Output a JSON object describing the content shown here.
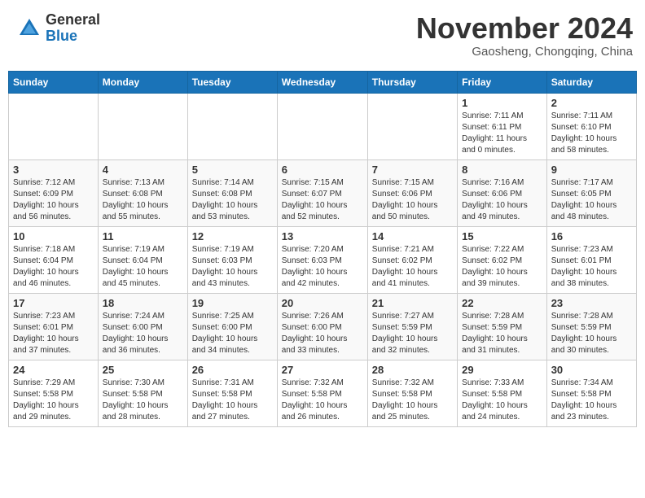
{
  "header": {
    "logo": {
      "general": "General",
      "blue": "Blue"
    },
    "title": "November 2024",
    "subtitle": "Gaosheng, Chongqing, China"
  },
  "calendar": {
    "weekdays": [
      "Sunday",
      "Monday",
      "Tuesday",
      "Wednesday",
      "Thursday",
      "Friday",
      "Saturday"
    ],
    "weeks": [
      [
        {
          "day": "",
          "sunrise": "",
          "sunset": "",
          "daylight": ""
        },
        {
          "day": "",
          "sunrise": "",
          "sunset": "",
          "daylight": ""
        },
        {
          "day": "",
          "sunrise": "",
          "sunset": "",
          "daylight": ""
        },
        {
          "day": "",
          "sunrise": "",
          "sunset": "",
          "daylight": ""
        },
        {
          "day": "",
          "sunrise": "",
          "sunset": "",
          "daylight": ""
        },
        {
          "day": "1",
          "sunrise": "Sunrise: 7:11 AM",
          "sunset": "Sunset: 6:11 PM",
          "daylight": "Daylight: 11 hours and 0 minutes."
        },
        {
          "day": "2",
          "sunrise": "Sunrise: 7:11 AM",
          "sunset": "Sunset: 6:10 PM",
          "daylight": "Daylight: 10 hours and 58 minutes."
        }
      ],
      [
        {
          "day": "3",
          "sunrise": "Sunrise: 7:12 AM",
          "sunset": "Sunset: 6:09 PM",
          "daylight": "Daylight: 10 hours and 56 minutes."
        },
        {
          "day": "4",
          "sunrise": "Sunrise: 7:13 AM",
          "sunset": "Sunset: 6:08 PM",
          "daylight": "Daylight: 10 hours and 55 minutes."
        },
        {
          "day": "5",
          "sunrise": "Sunrise: 7:14 AM",
          "sunset": "Sunset: 6:08 PM",
          "daylight": "Daylight: 10 hours and 53 minutes."
        },
        {
          "day": "6",
          "sunrise": "Sunrise: 7:15 AM",
          "sunset": "Sunset: 6:07 PM",
          "daylight": "Daylight: 10 hours and 52 minutes."
        },
        {
          "day": "7",
          "sunrise": "Sunrise: 7:15 AM",
          "sunset": "Sunset: 6:06 PM",
          "daylight": "Daylight: 10 hours and 50 minutes."
        },
        {
          "day": "8",
          "sunrise": "Sunrise: 7:16 AM",
          "sunset": "Sunset: 6:06 PM",
          "daylight": "Daylight: 10 hours and 49 minutes."
        },
        {
          "day": "9",
          "sunrise": "Sunrise: 7:17 AM",
          "sunset": "Sunset: 6:05 PM",
          "daylight": "Daylight: 10 hours and 48 minutes."
        }
      ],
      [
        {
          "day": "10",
          "sunrise": "Sunrise: 7:18 AM",
          "sunset": "Sunset: 6:04 PM",
          "daylight": "Daylight: 10 hours and 46 minutes."
        },
        {
          "day": "11",
          "sunrise": "Sunrise: 7:19 AM",
          "sunset": "Sunset: 6:04 PM",
          "daylight": "Daylight: 10 hours and 45 minutes."
        },
        {
          "day": "12",
          "sunrise": "Sunrise: 7:19 AM",
          "sunset": "Sunset: 6:03 PM",
          "daylight": "Daylight: 10 hours and 43 minutes."
        },
        {
          "day": "13",
          "sunrise": "Sunrise: 7:20 AM",
          "sunset": "Sunset: 6:03 PM",
          "daylight": "Daylight: 10 hours and 42 minutes."
        },
        {
          "day": "14",
          "sunrise": "Sunrise: 7:21 AM",
          "sunset": "Sunset: 6:02 PM",
          "daylight": "Daylight: 10 hours and 41 minutes."
        },
        {
          "day": "15",
          "sunrise": "Sunrise: 7:22 AM",
          "sunset": "Sunset: 6:02 PM",
          "daylight": "Daylight: 10 hours and 39 minutes."
        },
        {
          "day": "16",
          "sunrise": "Sunrise: 7:23 AM",
          "sunset": "Sunset: 6:01 PM",
          "daylight": "Daylight: 10 hours and 38 minutes."
        }
      ],
      [
        {
          "day": "17",
          "sunrise": "Sunrise: 7:23 AM",
          "sunset": "Sunset: 6:01 PM",
          "daylight": "Daylight: 10 hours and 37 minutes."
        },
        {
          "day": "18",
          "sunrise": "Sunrise: 7:24 AM",
          "sunset": "Sunset: 6:00 PM",
          "daylight": "Daylight: 10 hours and 36 minutes."
        },
        {
          "day": "19",
          "sunrise": "Sunrise: 7:25 AM",
          "sunset": "Sunset: 6:00 PM",
          "daylight": "Daylight: 10 hours and 34 minutes."
        },
        {
          "day": "20",
          "sunrise": "Sunrise: 7:26 AM",
          "sunset": "Sunset: 6:00 PM",
          "daylight": "Daylight: 10 hours and 33 minutes."
        },
        {
          "day": "21",
          "sunrise": "Sunrise: 7:27 AM",
          "sunset": "Sunset: 5:59 PM",
          "daylight": "Daylight: 10 hours and 32 minutes."
        },
        {
          "day": "22",
          "sunrise": "Sunrise: 7:28 AM",
          "sunset": "Sunset: 5:59 PM",
          "daylight": "Daylight: 10 hours and 31 minutes."
        },
        {
          "day": "23",
          "sunrise": "Sunrise: 7:28 AM",
          "sunset": "Sunset: 5:59 PM",
          "daylight": "Daylight: 10 hours and 30 minutes."
        }
      ],
      [
        {
          "day": "24",
          "sunrise": "Sunrise: 7:29 AM",
          "sunset": "Sunset: 5:58 PM",
          "daylight": "Daylight: 10 hours and 29 minutes."
        },
        {
          "day": "25",
          "sunrise": "Sunrise: 7:30 AM",
          "sunset": "Sunset: 5:58 PM",
          "daylight": "Daylight: 10 hours and 28 minutes."
        },
        {
          "day": "26",
          "sunrise": "Sunrise: 7:31 AM",
          "sunset": "Sunset: 5:58 PM",
          "daylight": "Daylight: 10 hours and 27 minutes."
        },
        {
          "day": "27",
          "sunrise": "Sunrise: 7:32 AM",
          "sunset": "Sunset: 5:58 PM",
          "daylight": "Daylight: 10 hours and 26 minutes."
        },
        {
          "day": "28",
          "sunrise": "Sunrise: 7:32 AM",
          "sunset": "Sunset: 5:58 PM",
          "daylight": "Daylight: 10 hours and 25 minutes."
        },
        {
          "day": "29",
          "sunrise": "Sunrise: 7:33 AM",
          "sunset": "Sunset: 5:58 PM",
          "daylight": "Daylight: 10 hours and 24 minutes."
        },
        {
          "day": "30",
          "sunrise": "Sunrise: 7:34 AM",
          "sunset": "Sunset: 5:58 PM",
          "daylight": "Daylight: 10 hours and 23 minutes."
        }
      ]
    ]
  }
}
